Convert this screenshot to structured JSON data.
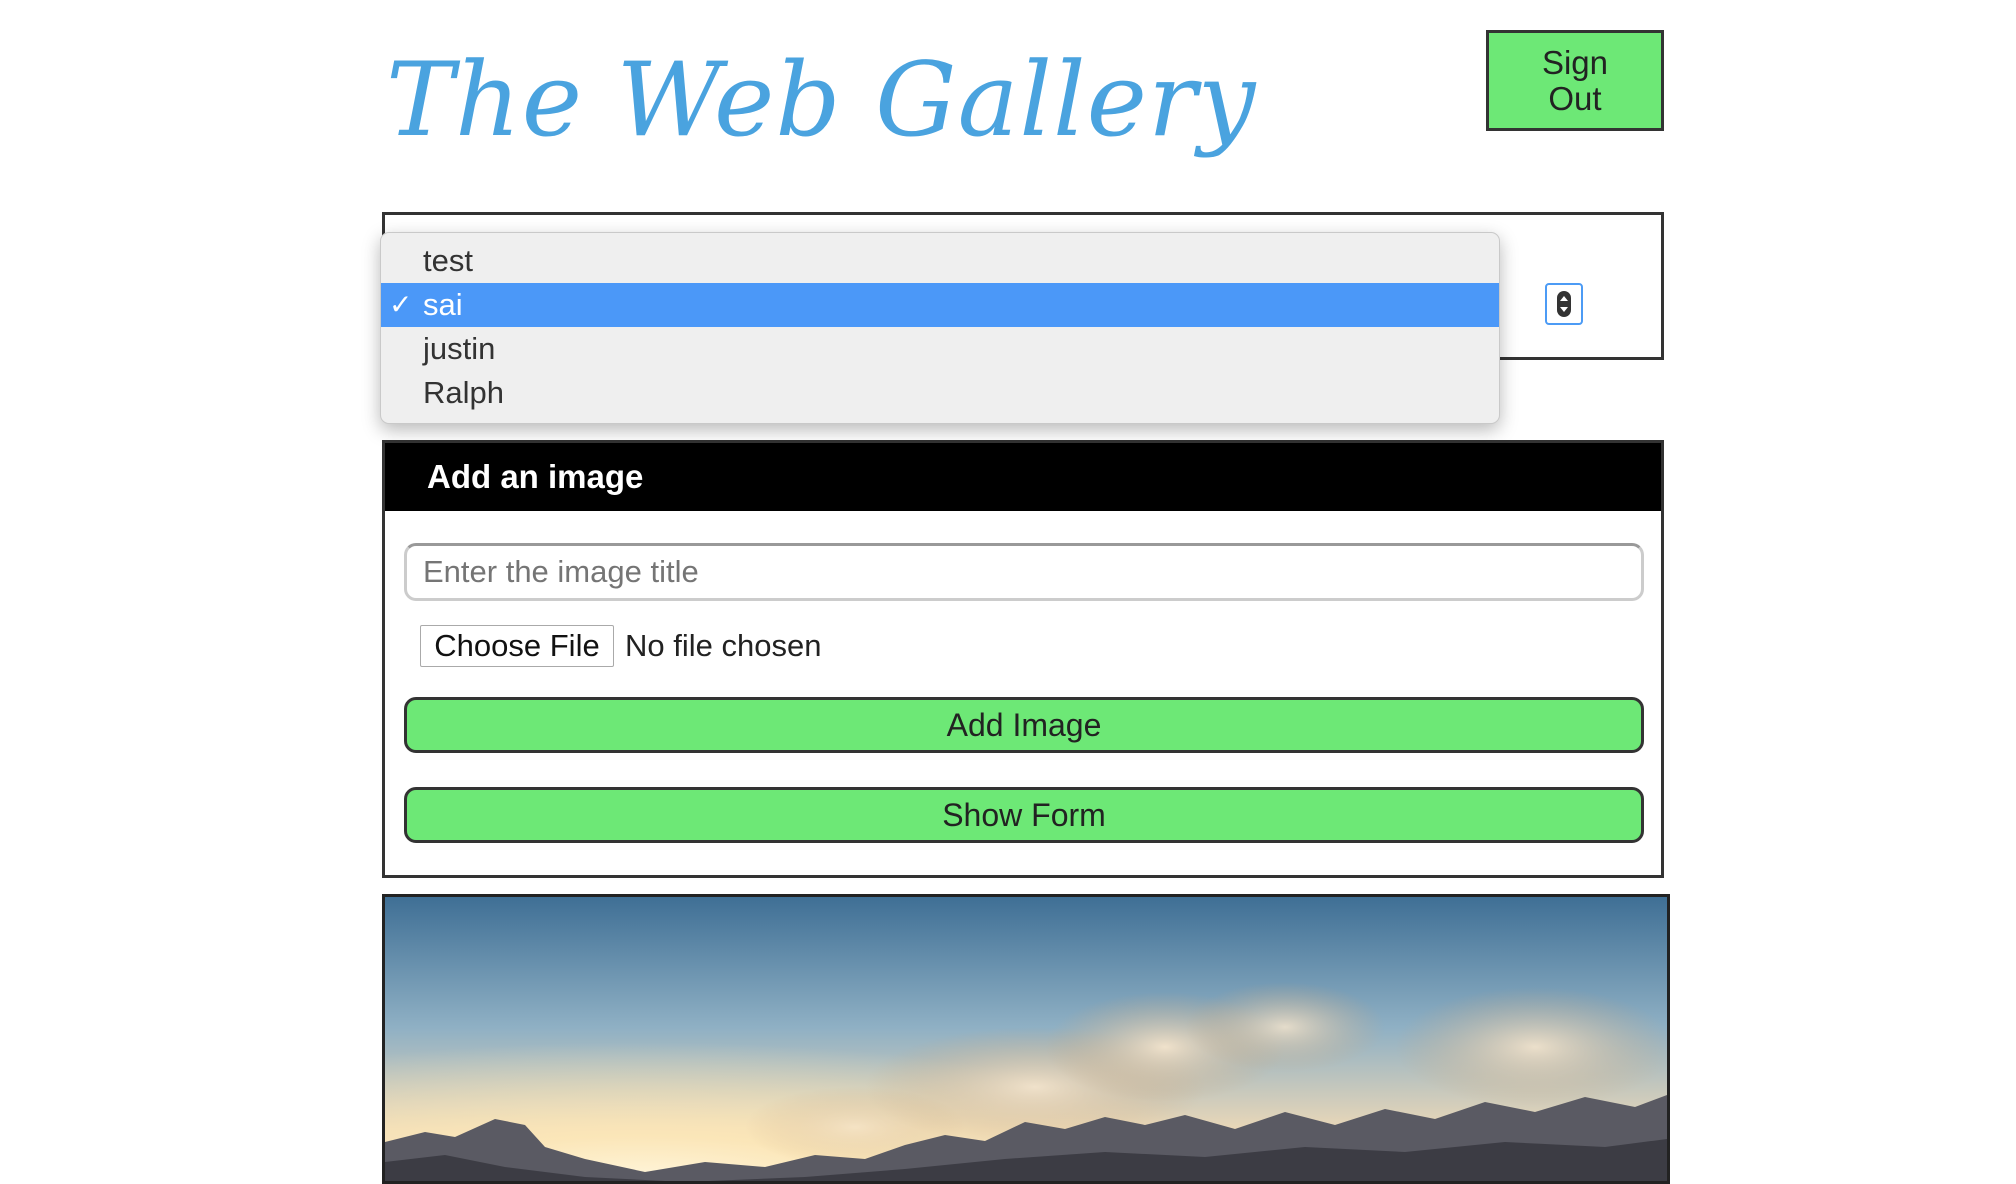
{
  "header": {
    "title": "The Web Gallery",
    "sign_out_label": "Sign\nOut"
  },
  "user_select": {
    "options": [
      {
        "label": "test",
        "selected": false
      },
      {
        "label": "sai",
        "selected": true
      },
      {
        "label": "justin",
        "selected": false
      },
      {
        "label": "Ralph",
        "selected": false
      }
    ],
    "check_mark": "✓"
  },
  "add_image_form": {
    "heading": "Add an image",
    "title_placeholder": "Enter the image title",
    "file_button_label": "Choose File",
    "file_status": "No file chosen",
    "add_button_label": "Add Image",
    "show_form_button_label": "Show Form"
  },
  "colors": {
    "title": "#4aa3df",
    "button_green": "#6de876",
    "selected_option": "#4b98f8",
    "form_header_bg": "#000000"
  }
}
